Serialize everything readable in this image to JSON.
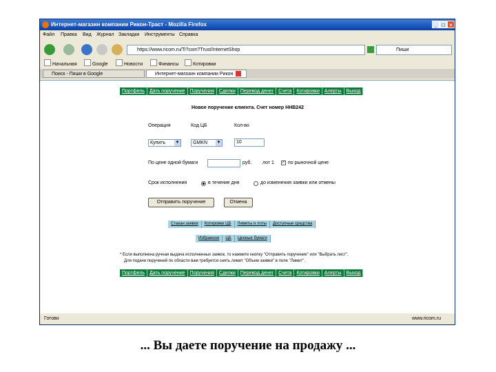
{
  "window": {
    "title": "Интернет-магазин компании Рикон-Траст - Mozilla Firefox",
    "min_btn": "_",
    "max_btn": "□",
    "close_btn": "×"
  },
  "menu": [
    "Файл",
    "Правка",
    "Вид",
    "Журнал",
    "Закладки",
    "Инструменты",
    "Справка"
  ],
  "nav": {
    "url": "https://www.ricom.ru/Ti?com?Trust/InternetShop",
    "search_text": "Пиши"
  },
  "bookmarks": [
    "Начальная",
    "Google",
    "Новости",
    "Финансы",
    "Котировки"
  ],
  "tabs": [
    {
      "label": "Поиск - Пиши в Google"
    },
    {
      "label": "Интернет-магазин компании Рикон"
    }
  ],
  "top_nav": [
    "Портфель",
    "Дать поручение",
    "Поручения",
    "Сделки",
    "Перевод денег",
    "Счета",
    "Котировки",
    "Алерты",
    "Выход"
  ],
  "form": {
    "title": "Новое поручение клиента. Счет номер HHB242",
    "col_operation": "Операция",
    "col_code": "Код ЦБ",
    "col_qty": "Кол-во",
    "operation_value": "Купить",
    "code_value": "GMKN",
    "qty_value": "10",
    "price_label": "По цене одной бумаги",
    "price_unit": "руб.",
    "lot_text": "лот 1",
    "market_label": "по рыночной цене",
    "term_label": "Срок исполнения",
    "term_opt1": "в течение дня",
    "term_opt2": "до изменения заявки или отмены",
    "submit_label": "Отправить поручение",
    "cancel_label": "Отмена"
  },
  "sub_nav1": [
    "Стакан заявок",
    "Котировки ЦБ",
    "Лимиты и лоты",
    "Доступные средства"
  ],
  "sub_nav2": [
    "Избранное",
    "ЦБ",
    "Ценные бумаги"
  ],
  "note_line1": "* Если выполнена ручная выдача исполненных заявок, то нажмите кнопку \"Отправить поручение\" или \"Выбрать лист\".",
  "note_line2": "Для подачи поручений по области вам требуется снять лимит \"Объем заявки\" в поле \"Лимит\".",
  "status": {
    "left": "Готово",
    "right": "www.ricom.ru"
  },
  "caption": "... Вы даете поручение на продажу ..."
}
